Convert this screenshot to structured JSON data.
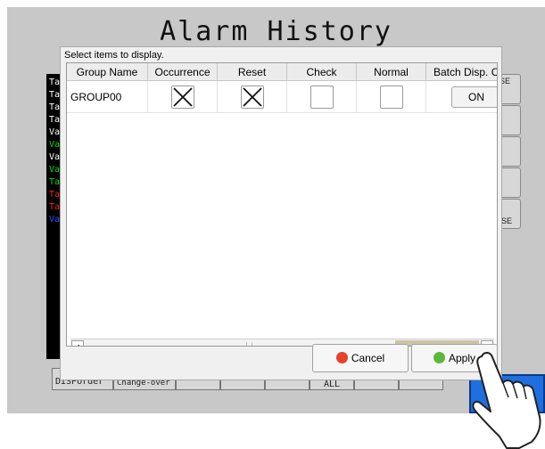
{
  "screen": {
    "title": "Alarm History"
  },
  "alarm_list": [
    {
      "text": "Ta",
      "color": "#ffffff"
    },
    {
      "text": "Ta",
      "color": "#ffffff"
    },
    {
      "text": "Ta",
      "color": "#ffffff"
    },
    {
      "text": "Ta",
      "color": "#ffffff"
    },
    {
      "text": "Va",
      "color": "#ffffff"
    },
    {
      "text": "Va",
      "color": "#00e000"
    },
    {
      "text": "Va",
      "color": "#ffffff"
    },
    {
      "text": "Va",
      "color": "#00e000"
    },
    {
      "text": "Ta",
      "color": "#00e000"
    },
    {
      "text": "Ta",
      "color": "#ff2020"
    },
    {
      "text": "Ta",
      "color": "#ff2020"
    },
    {
      "text": "Va",
      "color": "#3050ff"
    }
  ],
  "right_buttons": [
    "SE",
    "",
    "",
    "",
    "SE"
  ],
  "bottom_buttons": {
    "display_order": "DISPOrder",
    "change_over": "Change-over",
    "all": "ALL"
  },
  "dialog": {
    "caption": "Select items to display.",
    "columns": [
      "Group Name",
      "Occurrence",
      "Reset",
      "Check",
      "Normal",
      "Batch Disp. Ch"
    ],
    "rows": [
      {
        "group_name": "GROUP00",
        "occurrence": true,
        "reset": true,
        "check": false,
        "normal": false,
        "batch_label": "ON"
      }
    ],
    "cancel_label": "Cancel",
    "apply_label": "Apply",
    "colors": {
      "cancel_icon": "#e8402a",
      "apply_icon": "#5cb83a"
    }
  }
}
